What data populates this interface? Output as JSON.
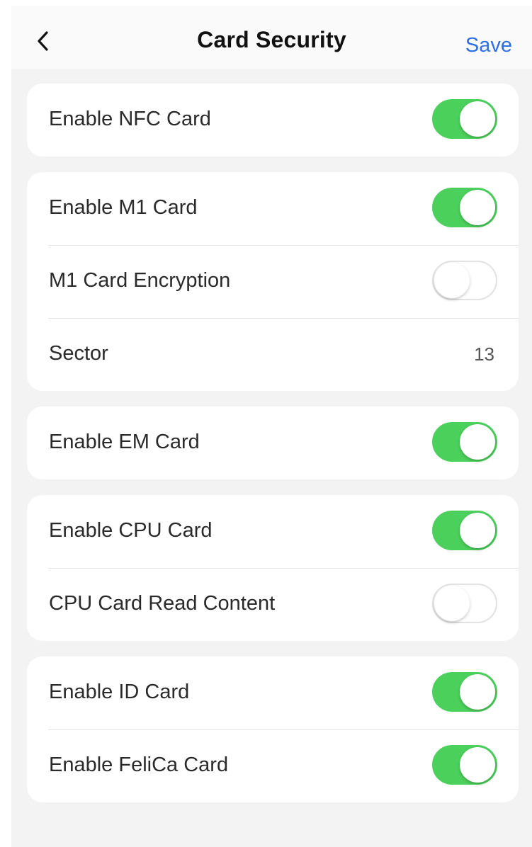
{
  "header": {
    "title": "Card Security",
    "save_label": "Save"
  },
  "groups": [
    {
      "rows": [
        {
          "label": "Enable NFC Card",
          "type": "toggle",
          "on": true
        }
      ]
    },
    {
      "rows": [
        {
          "label": "Enable M1 Card",
          "type": "toggle",
          "on": true
        },
        {
          "label": "M1 Card Encryption",
          "type": "toggle",
          "on": false
        },
        {
          "label": "Sector",
          "type": "value",
          "value": "13"
        }
      ]
    },
    {
      "rows": [
        {
          "label": "Enable EM Card",
          "type": "toggle",
          "on": true
        }
      ]
    },
    {
      "rows": [
        {
          "label": "Enable CPU Card",
          "type": "toggle",
          "on": true
        },
        {
          "label": "CPU Card Read Content",
          "type": "toggle",
          "on": false
        }
      ]
    },
    {
      "rows": [
        {
          "label": "Enable ID Card",
          "type": "toggle",
          "on": true
        },
        {
          "label": "Enable FeliCa Card",
          "type": "toggle",
          "on": true
        }
      ]
    }
  ],
  "colors": {
    "toggle_on": "#4cd05c",
    "link": "#2f6fe0",
    "background": "#f3f3f3"
  }
}
